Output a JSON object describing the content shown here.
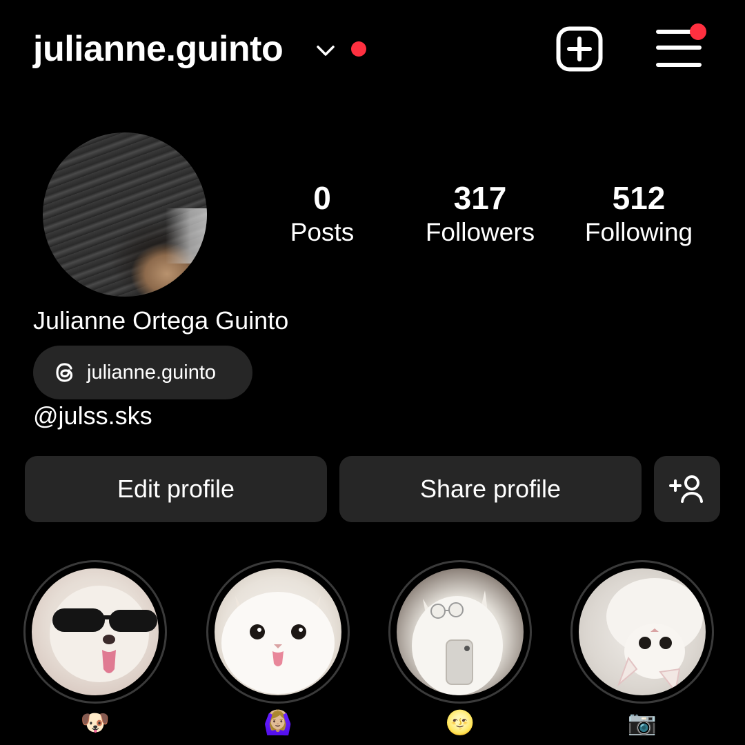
{
  "header": {
    "username": "julianne.guinto",
    "notification_dot_color": "#ff3040",
    "icons": [
      "chevron-down-icon",
      "new-post-icon",
      "menu-icon"
    ]
  },
  "profile": {
    "full_name": "Julianne Ortega Guinto",
    "threads_handle": "julianne.guinto",
    "bio": "@julss.sks"
  },
  "stats": [
    {
      "value": "0",
      "label": "Posts"
    },
    {
      "value": "317",
      "label": "Followers"
    },
    {
      "value": "512",
      "label": "Following"
    }
  ],
  "buttons": {
    "edit": "Edit profile",
    "share": "Share profile",
    "add_person_icon": "add-person-icon"
  },
  "highlights": [
    {
      "label": "🐶"
    },
    {
      "label": "🙆🏼‍♀️"
    },
    {
      "label": "🌝"
    },
    {
      "label": "📷"
    }
  ],
  "colors": {
    "background": "#000000",
    "button": "#262626",
    "text": "#ffffff"
  }
}
